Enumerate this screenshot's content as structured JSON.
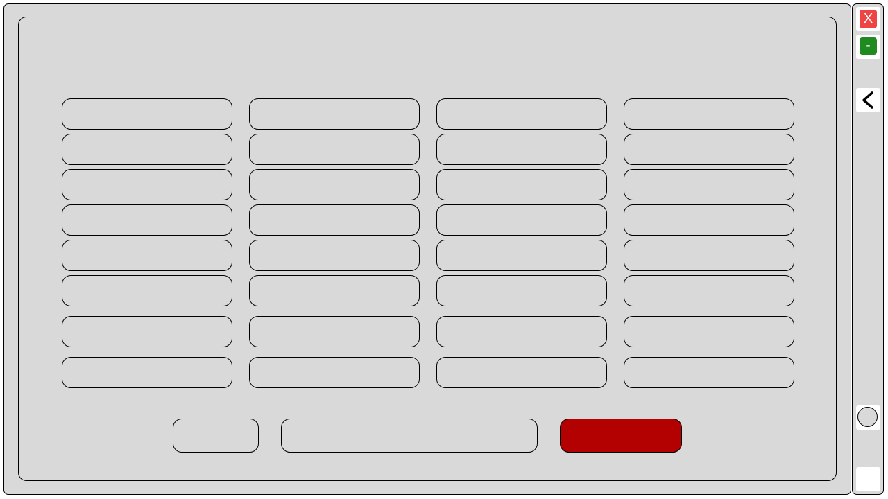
{
  "colors": {
    "frame_bg": "#d9d9d9",
    "close_red": "#ef4444",
    "minimize_green": "#1f8a1f",
    "action_red": "#b30000"
  },
  "window_controls": {
    "close_label": "X",
    "minimize_label": "-"
  },
  "icons": {
    "close": "close-icon",
    "minimize": "minimize-icon",
    "back": "chevron-left-icon",
    "circle": "circle-icon"
  }
}
